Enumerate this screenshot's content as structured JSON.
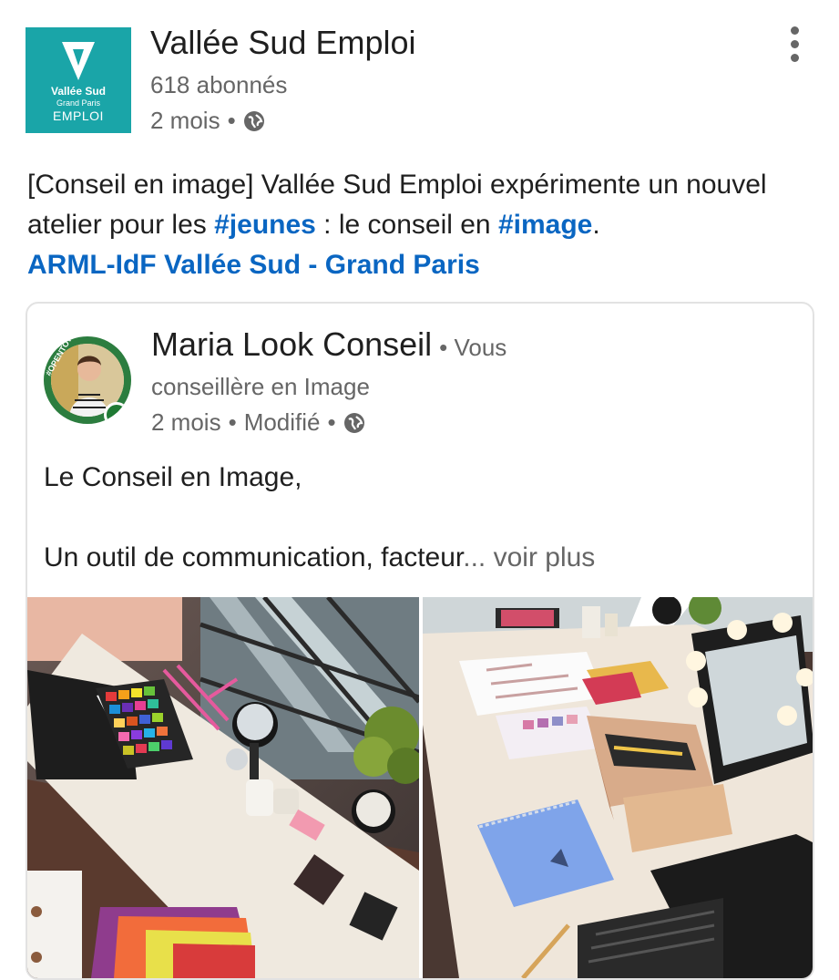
{
  "post": {
    "author_name": "Vallée Sud Emploi",
    "followers": "618 abonnés",
    "time": "2 mois",
    "separator": "•",
    "logo": {
      "line1": "Vallée Sud",
      "line2": "Grand Paris",
      "line3": "EMPLOI",
      "color": "#1aa5a8"
    },
    "text": {
      "part1": "[Conseil en image] Vallée Sud Emploi expérimente un nouvel atelier pour les ",
      "hashtag1": "#jeunes",
      "part2": " : le conseil en ",
      "hashtag2": "#image",
      "part3": ".",
      "mention": "ARML-IdF Vallée Sud - Grand Paris"
    }
  },
  "shared": {
    "author_name": "Maria Look Conseil",
    "relation": "• Vous",
    "headline": "conseillère en Image",
    "time": "2 mois",
    "edited": "Modifié",
    "separator": "•",
    "badge_text": "#OPENTOWORK",
    "line1": "Le Conseil en Image,",
    "line2": "Un outil de communication, facteur",
    "ellipsis": "...",
    "see_more": " voir plus"
  },
  "icons": {
    "globe": "globe-icon",
    "more": "more-vertical-icon"
  },
  "colors": {
    "link": "#0a66c2",
    "muted": "#666666",
    "open_to_work": "#2c7d3f"
  }
}
